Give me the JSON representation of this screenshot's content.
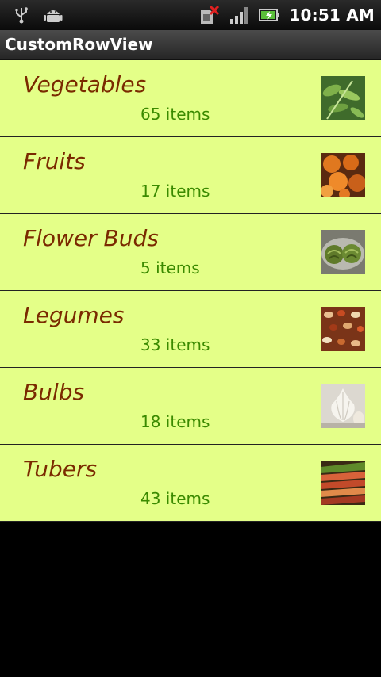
{
  "status_bar": {
    "time": "10:51 AM",
    "icons": [
      "usb-icon",
      "android-debug-icon",
      "no-sim-icon",
      "signal-icon",
      "battery-charging-icon"
    ]
  },
  "app": {
    "title": "CustomRowView"
  },
  "rows": [
    {
      "name": "Vegetables",
      "count": "65 items",
      "thumb_icon": "vegetables-thumbnail"
    },
    {
      "name": "Fruits",
      "count": "17 items",
      "thumb_icon": "fruits-thumbnail"
    },
    {
      "name": "Flower Buds",
      "count": "5 items",
      "thumb_icon": "flower-buds-thumbnail"
    },
    {
      "name": "Legumes",
      "count": "33 items",
      "thumb_icon": "legumes-thumbnail"
    },
    {
      "name": "Bulbs",
      "count": "18 items",
      "thumb_icon": "bulbs-thumbnail"
    },
    {
      "name": "Tubers",
      "count": "43 items",
      "thumb_icon": "tubers-thumbnail"
    }
  ],
  "colors": {
    "row_background": "#e4ff88",
    "name_text": "#7a2a00",
    "count_text": "#3a8a00",
    "page_background": "#000000"
  }
}
